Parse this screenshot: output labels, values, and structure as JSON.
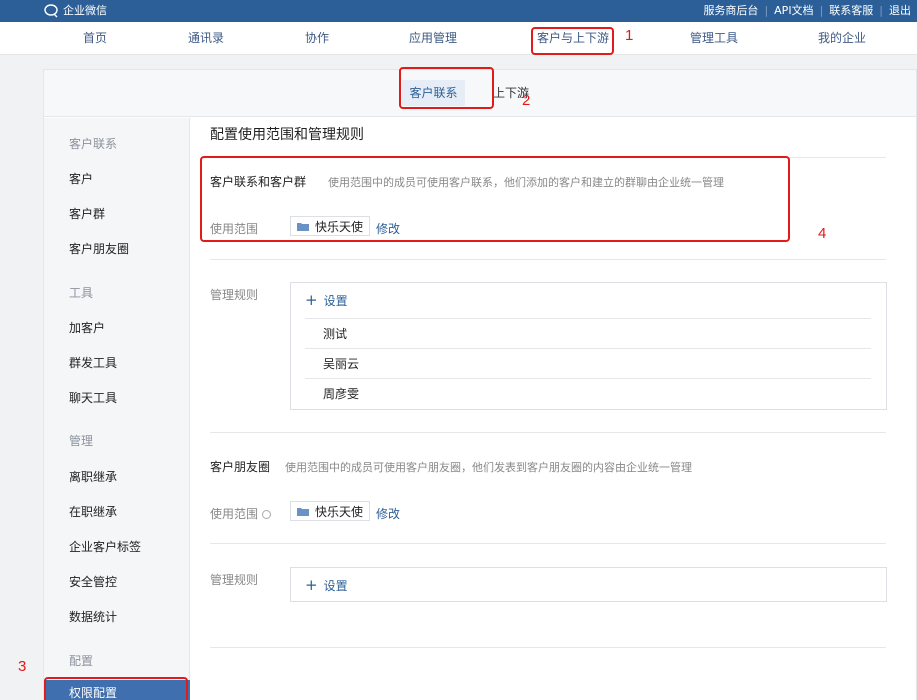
{
  "topbar": {
    "logo_text": "企业微信",
    "links": [
      "服务商后台",
      "API文档",
      "联系客服",
      "退出"
    ]
  },
  "nav": {
    "items": [
      "首页",
      "通讯录",
      "协作",
      "应用管理",
      "客户与上下游",
      "管理工具",
      "我的企业"
    ]
  },
  "subtabs": {
    "active": "客户联系",
    "other": "上下游"
  },
  "sidebar": {
    "group_customer": "客户联系",
    "customer_items": [
      "客户",
      "客户群",
      "客户朋友圈"
    ],
    "group_tools": "工具",
    "tool_items": [
      "加客户",
      "群发工具",
      "聊天工具"
    ],
    "group_manage": "管理",
    "manage_items": [
      "离职继承",
      "在职继承",
      "企业客户标签",
      "安全管控",
      "数据统计"
    ],
    "group_config": "配置",
    "config_items": [
      "权限配置"
    ]
  },
  "content": {
    "title": "配置使用范围和管理规则",
    "section1": {
      "title": "客户联系和客户群",
      "desc": "使用范围中的成员可使用客户联系，他们添加的客户和建立的群聊由企业统一管理",
      "scope_label": "使用范围",
      "scope_value": "快乐天使",
      "edit": "修改",
      "rules_label": "管理规则",
      "add_rule": "设置",
      "rules": [
        "测试",
        "吴丽云",
        "周彦雯"
      ]
    },
    "section2": {
      "title": "客户朋友圈",
      "desc": "使用范围中的成员可使用客户朋友圈，他们发表到客户朋友圈的内容由企业统一管理",
      "scope_label": "使用范围",
      "scope_value": "快乐天使",
      "edit": "修改",
      "rules_label": "管理规则",
      "add_rule": "设置"
    }
  },
  "annotations": [
    "1",
    "2",
    "3",
    "4"
  ],
  "colors": {
    "topbar": "#2c5f98",
    "link": "#2c5f98",
    "annotation": "#e11a1a",
    "sidebar_active": "#3f6fae"
  }
}
